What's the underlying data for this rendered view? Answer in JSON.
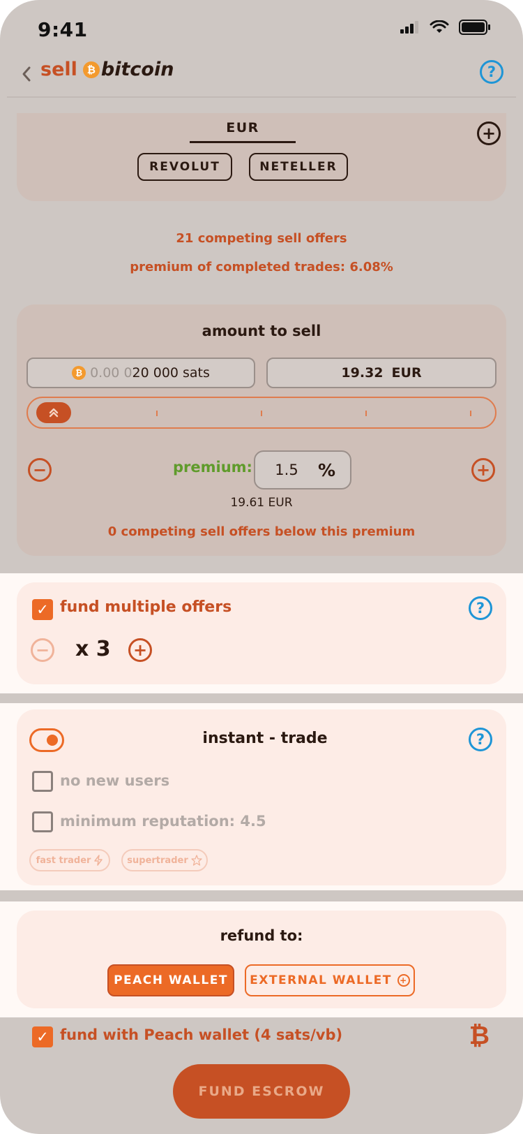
{
  "status_bar": {
    "time": "9:41"
  },
  "header": {
    "title_sell": "sell",
    "title_bitcoin": "bitcoin",
    "coin_symbol": "₿",
    "help_icon": "question-icon"
  },
  "payment": {
    "currency_tab": "EUR",
    "methods": [
      "REVOLUT",
      "NETELLER"
    ]
  },
  "market": {
    "competing_offers": "21 competing sell offers",
    "premium_completed": "premium of completed trades: 6.08%"
  },
  "amount": {
    "title": "amount to sell",
    "sats_faded": "0.00 0",
    "sats_value": "20 000",
    "sats_unit": "sats",
    "fiat_value": "19.32",
    "fiat_currency": "EUR",
    "slider_level": 0,
    "premium_label": "premium:",
    "premium_value": "1.5",
    "premium_unit": "%",
    "premium_eur": "19.61 EUR",
    "below_premium": "0 competing sell offers below this premium"
  },
  "fund_multiple": {
    "label": "fund multiple offers",
    "checked": true,
    "count": "x 3"
  },
  "instant_trade": {
    "enabled": true,
    "title": "instant - trade",
    "no_new_users": "no new users",
    "min_reputation": "minimum reputation: 4.5",
    "tags": [
      "fast trader",
      "supertrader"
    ]
  },
  "refund": {
    "title": "refund to:",
    "peach_wallet": "PEACH WALLET",
    "external_wallet": "EXTERNAL WALLET"
  },
  "fund_with_peach": {
    "label": "fund with Peach wallet (4 sats/vb)",
    "checked": true
  },
  "cta": {
    "label": "FUND ESCROW"
  },
  "colors": {
    "accent": "#c65024",
    "orange": "#ec6a26",
    "help_blue": "#1e95d6",
    "premium_green": "#5f9b2b"
  }
}
